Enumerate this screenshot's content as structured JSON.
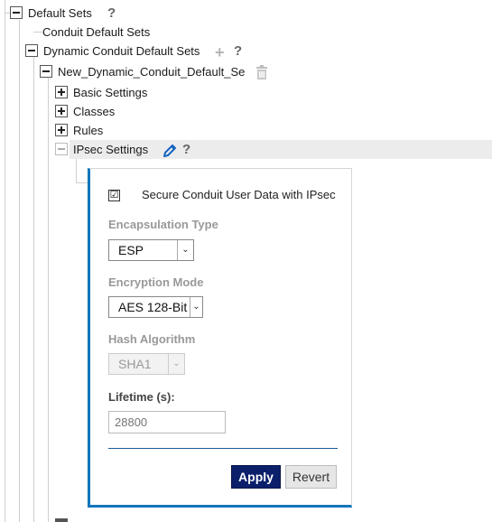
{
  "tree": {
    "default_sets": {
      "label": "Default Sets",
      "help": "?"
    },
    "conduit_default_sets": {
      "label": "Conduit Default Sets"
    },
    "dynamic_conduit_default_sets": {
      "label": "Dynamic Conduit Default Sets",
      "add": "+",
      "help": "?"
    },
    "new_item": {
      "label": "New_Dynamic_Conduit_Default_Se"
    },
    "basic_settings": {
      "label": "Basic Settings"
    },
    "classes": {
      "label": "Classes"
    },
    "rules": {
      "label": "Rules"
    },
    "ipsec_settings": {
      "label": "IPsec Settings",
      "help": "?"
    }
  },
  "panel": {
    "secure_checkbox": {
      "label": "Secure Conduit User Data with IPsec",
      "checked": true,
      "mark": "☑"
    },
    "encapsulation": {
      "label": "Encapsulation Type",
      "value": "ESP"
    },
    "encryption": {
      "label": "Encryption Mode",
      "value": "AES 128-Bit"
    },
    "hash": {
      "label": "Hash Algorithm",
      "value": "SHA1",
      "disabled": true
    },
    "lifetime": {
      "label": "Lifetime (s):",
      "placeholder": "28800"
    },
    "apply_label": "Apply",
    "revert_label": "Revert"
  },
  "colors": {
    "accent": "#0e76bd",
    "apply_bg": "#0b1f6b",
    "selected_row": "#ececec"
  }
}
